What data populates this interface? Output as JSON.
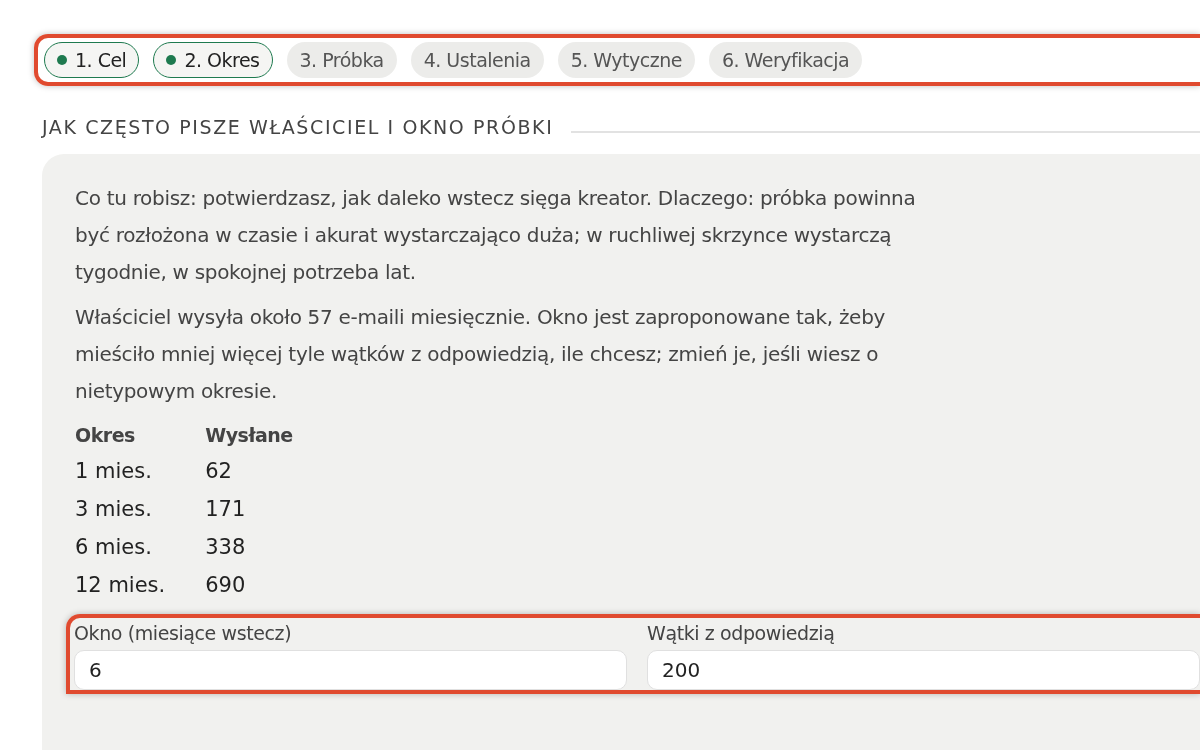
{
  "steps": [
    {
      "label": "1. Cel",
      "done": true
    },
    {
      "label": "2. Okres",
      "done": true
    },
    {
      "label": "3. Próbka",
      "done": false
    },
    {
      "label": "4. Ustalenia",
      "done": false
    },
    {
      "label": "5. Wytyczne",
      "done": false
    },
    {
      "label": "6. Weryfikacja",
      "done": false
    }
  ],
  "section_title": "JAK CZĘSTO PISZE WŁAŚCICIEL I OKNO PRÓBKI",
  "paragraphs": [
    "Co tu robisz: potwierdzasz, jak daleko wstecz sięga kreator. Dlaczego: próbka powinna być rozłożona w czasie i akurat wystarczająco duża; w ruchliwej skrzynce wystarczą tygodnie, w spokojnej potrzeba lat.",
    "Właściciel wysyła około 57 e-maili miesięcznie. Okno jest zaproponowane tak, żeby mieściło mniej więcej tyle wątków z odpowiedzią, ile chcesz; zmień je, jeśli wiesz o nietypowym okresie."
  ],
  "table": {
    "columns": [
      "Okres",
      "Wysłane"
    ],
    "rows": [
      [
        "1 mies.",
        "62"
      ],
      [
        "3 mies.",
        "171"
      ],
      [
        "6 mies.",
        "338"
      ],
      [
        "12 mies.",
        "690"
      ]
    ]
  },
  "fields": [
    {
      "label": "Okno (miesiące wstecz)",
      "value": "6"
    },
    {
      "label": "Wątki z odpowiedzią",
      "value": "200"
    }
  ]
}
